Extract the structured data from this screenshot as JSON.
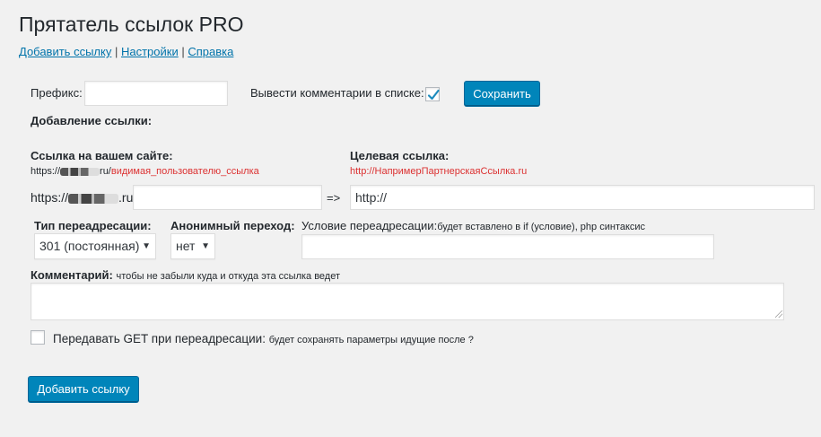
{
  "page": {
    "title": "Прятатель ссылок PRO",
    "nav": [
      {
        "label": "Добавить ссылку"
      },
      {
        "label": "Настройки"
      },
      {
        "label": "Справка"
      }
    ],
    "nav_separator": "|"
  },
  "settings": {
    "prefix_label": "Префикс:",
    "prefix_value": "",
    "show_comments_label": "Вывести комментарии в списке:",
    "show_comments_checked": true,
    "save_button": "Сохранить"
  },
  "add_link": {
    "heading": "Добавление ссылки:",
    "site_link_label": "Ссылка на вашем сайте:",
    "site_link_example_prefix": "https://",
    "site_link_example_domain_suffix": "ru/",
    "site_link_example_path": "видимая_пользователю_ссылка",
    "target_link_label": "Целевая ссылка:",
    "target_link_example": "http://НапримерПартнерскаяСсылка.ru",
    "site_prefix_prefix": "https://",
    "site_prefix_suffix": ".ru/",
    "path_value": "",
    "arrow": "=>",
    "target_value": "http://"
  },
  "redirect": {
    "type_label": "Тип переадресации:",
    "type_selected": "301 (постоянная)",
    "anon_label": "Анонимный переход:",
    "anon_selected": "нет",
    "condition_label": "Условие переадресации:",
    "condition_hint": "будет вставлено в if (условие), php синтаксис",
    "condition_value": ""
  },
  "comment": {
    "label": "Комментарий:",
    "hint": "чтобы не забыли куда и откуда эта ссылка ведет",
    "value": ""
  },
  "get_params": {
    "label": "Передавать GET при переадресации:",
    "hint": "будет сохранять параметры идущие после ?",
    "checked": false
  },
  "submit_button": "Добавить ссылку",
  "colors": {
    "accent": "#0085ba",
    "link": "#0073aa",
    "hint_red": "#dc3232",
    "background": "#f1f1f1"
  },
  "icons": {
    "checkmark": "checkmark-icon",
    "caret": "caret-down-icon",
    "resize": "resize-handle-icon"
  }
}
